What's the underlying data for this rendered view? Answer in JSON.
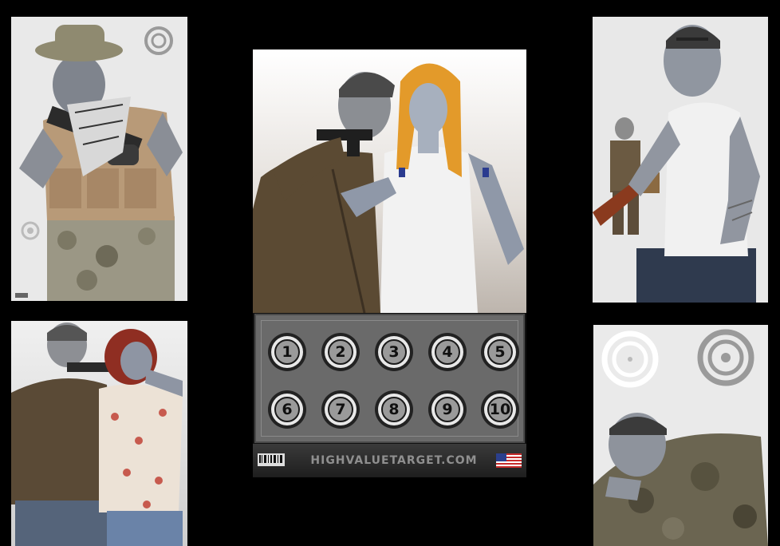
{
  "center_target": {
    "numbers": [
      "1",
      "2",
      "3",
      "4",
      "5",
      "6",
      "7",
      "8",
      "9",
      "10"
    ],
    "brand": "HIGHVALUETARGET.COM"
  },
  "colors": {
    "background": "#000000",
    "target_paper": "#e6e6e6",
    "grid_panel": "#6a6a6a",
    "footer": "#2a2a2a"
  },
  "icons": {
    "barcode": "barcode-icon",
    "flag": "us-flag-icon",
    "bullseye": "bullseye-icon"
  }
}
